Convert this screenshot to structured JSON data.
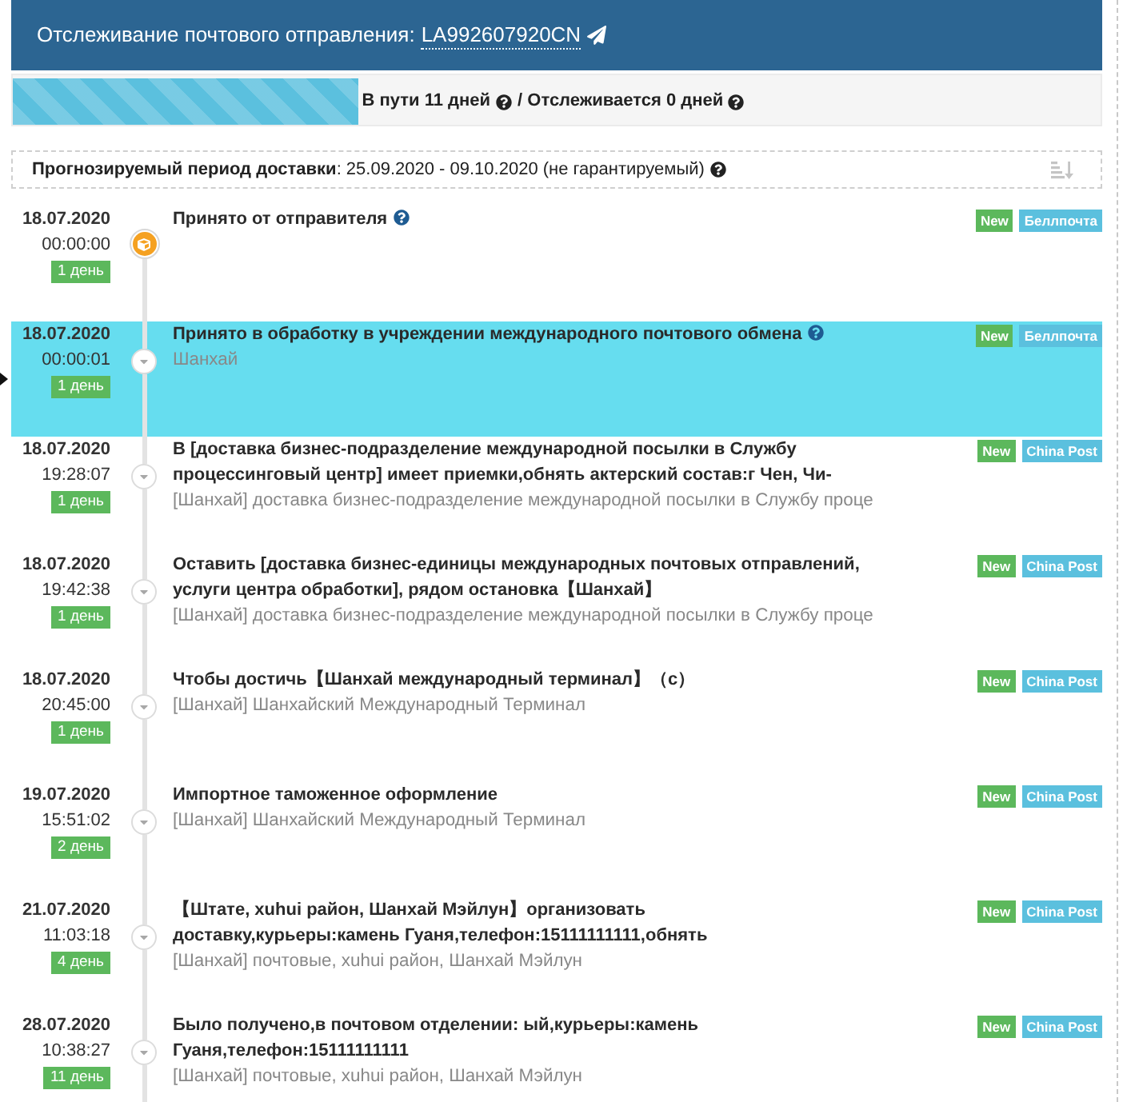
{
  "header": {
    "title": "Отслеживание почтового отправления:",
    "tracking_number": "LA992607920CN"
  },
  "progress": {
    "level": 0.318,
    "in_transit": "В пути 11 дней",
    "tracked": "/ Отслеживается 0 дней"
  },
  "forecast": {
    "text": "**Прогнозируемый период доставки**: 25.09.2020 - 09.10.2020 (не гарантируемый)"
  },
  "events": [
    {
      "date": "18.07.2020",
      "time": "00:00:00",
      "days": "1 день",
      "kind": "origin",
      "title": "Принято от отправителя",
      "help": true,
      "badges": [
        {
          "label": "New",
          "kind": "new"
        },
        {
          "label": "Беллпочта",
          "kind": "carrier"
        }
      ],
      "selected": false
    },
    {
      "date": "18.07.2020",
      "time": "00:00:01",
      "days": "1 день",
      "kind": "transit",
      "title": "Принято в обработку в учреждении международного почтового обмена",
      "help": true,
      "location": "Шанхай",
      "badges": [
        {
          "label": "New",
          "kind": "new"
        },
        {
          "label": "Беллпочта",
          "kind": "carrier"
        }
      ],
      "selected": true
    },
    {
      "date": "18.07.2020",
      "time": "19:28:07",
      "days": "1 день",
      "kind": "transit",
      "title": "В [доставка бизнес-подразделение международной посылки в Службу процессинговый центр] имеет приемки,обнять актерский состав:г Чен, Чи-",
      "help": false,
      "location": "[Шанхай] доставка бизнес-подразделение международной посылки в Службу проце",
      "badges": [
        {
          "label": "New",
          "kind": "new"
        },
        {
          "label": "China Post",
          "kind": "carrier"
        }
      ],
      "selected": false
    },
    {
      "date": "18.07.2020",
      "time": "19:42:38",
      "days": "1 день",
      "kind": "transit",
      "title": "Оставить [доставка бизнес-единицы международных почтовых отправлений, услуги центра обработки], рядом остановка【Шанхай】",
      "help": false,
      "location": "[Шанхай] доставка бизнес-подразделение международной посылки в Службу проце",
      "badges": [
        {
          "label": "New",
          "kind": "new"
        },
        {
          "label": "China Post",
          "kind": "carrier"
        }
      ],
      "selected": false
    },
    {
      "date": "18.07.2020",
      "time": "20:45:00",
      "days": "1 день",
      "kind": "transit",
      "title": "Чтобы достичь【Шанхай международный терминал】（с）",
      "help": false,
      "location": "[Шанхай] Шанхайский Международный Терминал",
      "badges": [
        {
          "label": "New",
          "kind": "new"
        },
        {
          "label": "China Post",
          "kind": "carrier"
        }
      ],
      "selected": false
    },
    {
      "date": "19.07.2020",
      "time": "15:51:02",
      "days": "2 день",
      "kind": "transit",
      "title": "Импортное таможенное оформление",
      "help": false,
      "location": "[Шанхай] Шанхайский Международный Терминал",
      "badges": [
        {
          "label": "New",
          "kind": "new"
        },
        {
          "label": "China Post",
          "kind": "carrier"
        }
      ],
      "selected": false
    },
    {
      "date": "21.07.2020",
      "time": "11:03:18",
      "days": "4 день",
      "kind": "transit",
      "title": "【Штате, xuhui район, Шанхай Мэйлун】организовать доставку,курьеры:камень Гуаня,телефон:15111111111,обнять",
      "help": false,
      "location": "[Шанхай] почтовые, xuhui район, Шанхай Мэйлун",
      "badges": [
        {
          "label": "New",
          "kind": "new"
        },
        {
          "label": "China Post",
          "kind": "carrier"
        }
      ],
      "selected": false
    },
    {
      "date": "28.07.2020",
      "time": "10:38:27",
      "days": "11 день",
      "kind": "transit",
      "title": "Было получено,в почтовом отделении: ый,курьеры:камень Гуаня,телефон:15111111111",
      "help": false,
      "location": "[Шанхай] почтовые, xuhui район, Шанхай Мэйлун",
      "badges": [
        {
          "label": "New",
          "kind": "new"
        },
        {
          "label": "China Post",
          "kind": "carrier"
        }
      ],
      "selected": false
    }
  ]
}
